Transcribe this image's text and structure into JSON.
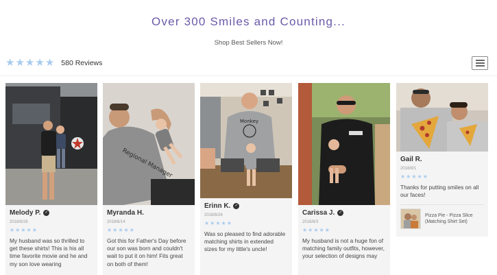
{
  "header": {
    "headline": "Over 300 Smiles and Counting...",
    "subline": "Shop Best Sellers Now!"
  },
  "summary": {
    "rating": 5,
    "review_count_label": "580 Reviews",
    "star_color": "#a9cbee"
  },
  "menu": {
    "icon": "hamburger-icon"
  },
  "accent_color": "#6b5aa8",
  "reviews": [
    {
      "name": "Melody P.",
      "date": "2018/8/26",
      "rating": 5,
      "text": "My husband was so thrilled to get these shirts! This is his all time favorite movie and he and my son love wearing",
      "photo": "man-and-son-by-truck-photo"
    },
    {
      "name": "Myranda H.",
      "date": "2018/6/14",
      "rating": 5,
      "text": "Got this for Father's Day before our son was born and couldn't wait to put it on him! Fits great on both of them!",
      "photo": "dad-and-baby-lying-photo",
      "shirt_text": "Regional Manager"
    },
    {
      "name": "Erinn K.",
      "date": "2018/8/26",
      "rating": 5,
      "text": "Was so pleased to find adorable matching shirts in extended sizes for my little's uncle!",
      "photo": "man-sitting-with-toddler-photo",
      "shirt_text": "Monkey"
    },
    {
      "name": "Carissa J.",
      "date": "2018/8/3",
      "rating": 5,
      "text": "My husband is not a huge fon of matching family outfits, however, your selection of designs may",
      "photo": "man-holding-baby-outdoors-photo"
    },
    {
      "name": "Gail R.",
      "date": "2018/8/1",
      "rating": 5,
      "text": "Thanks for putting smiles on all our faces!",
      "photo": "pizza-shirts-selfie-photo",
      "product": "Pizza Pie - Pizza Slice (Matching Shirt Set)"
    }
  ]
}
